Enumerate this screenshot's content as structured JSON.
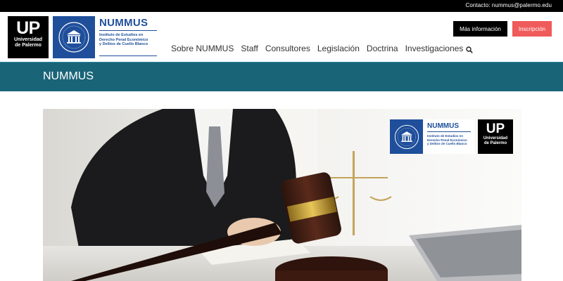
{
  "topbar": {
    "contact": "Contacto: nummus@palermo.edu"
  },
  "logo_up": {
    "mark": "UP",
    "line1": "Universidad",
    "line2": "de Palermo"
  },
  "logo_nummus": {
    "title": "NUMMUS",
    "subtitle_line1": "Instituto de Estudios en",
    "subtitle_line2": "Derecho Penal Económico",
    "subtitle_line3": "y Delitos de Cuello Blanco",
    "icon": "columned-building-seal-icon"
  },
  "nav": {
    "items": [
      "Sobre NUMMUS",
      "Staff",
      "Consultores",
      "Legislación",
      "Doctrina",
      "Investigaciones"
    ],
    "search_icon": "search-icon"
  },
  "buttons": {
    "info": "Más información",
    "inscripcion": "Inscripción"
  },
  "band": {
    "title": "NUMMUS"
  },
  "hero": {
    "badge_nummus_title": "NUMMUS",
    "badge_sub1": "Instituto de Estudios en",
    "badge_sub2": "Derecho Penal Económico",
    "badge_sub3": "y Delitos de Cuello Blanco",
    "badge_up_mark": "UP",
    "badge_up_line1": "Universidad",
    "badge_up_line2": "de Palermo"
  },
  "colors": {
    "brand_blue": "#1f4f9b",
    "teal_band": "#1a6478",
    "cta_red": "#ef5a5a",
    "black": "#000000"
  }
}
